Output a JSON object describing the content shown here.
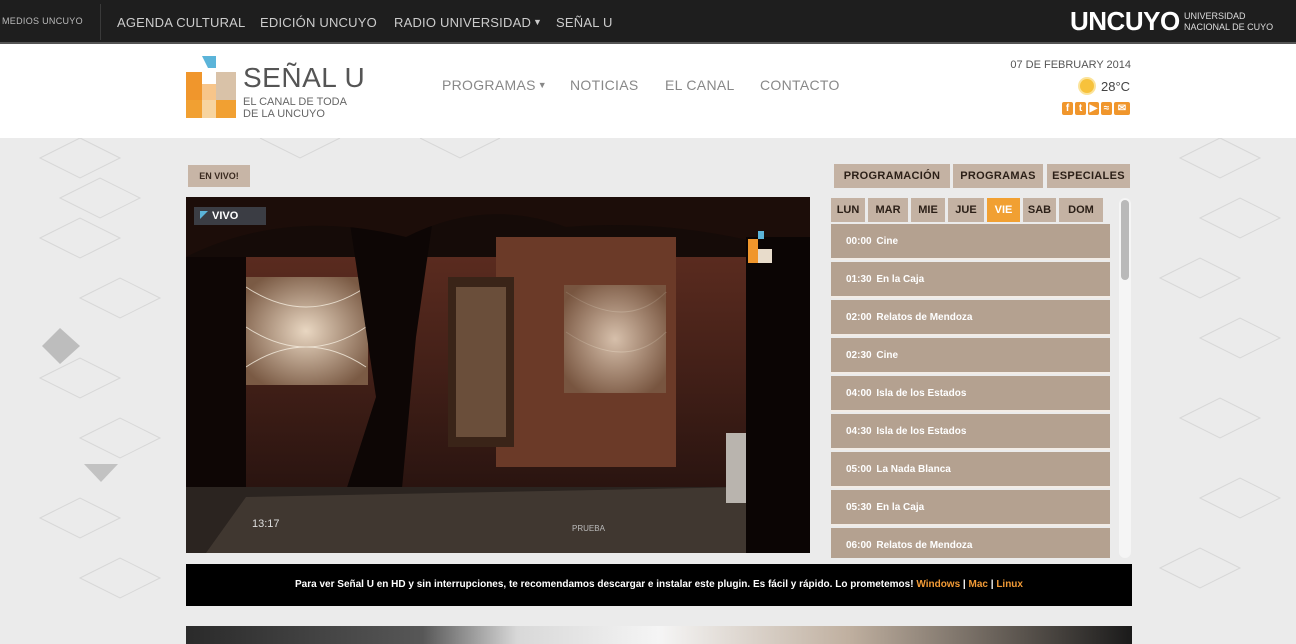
{
  "topbar": {
    "medios": "MEDIOS UNCUYO",
    "links": [
      {
        "label": "AGENDA CULTURAL"
      },
      {
        "label": "EDICIÓN UNCUYO"
      },
      {
        "label": "RADIO UNIVERSIDAD"
      },
      {
        "label": "SEÑAL U"
      }
    ],
    "brand": "UNCUYO",
    "brand_sub_1": "UNIVERSIDAD",
    "brand_sub_2": "NACIONAL DE CUYO"
  },
  "header": {
    "logo_title": "SEÑAL U",
    "logo_sub_1": "EL CANAL DE TODA",
    "logo_sub_2": "DE LA UNCUYO",
    "nav": [
      {
        "label": "PROGRAMAS"
      },
      {
        "label": "NOTICIAS"
      },
      {
        "label": "EL CANAL"
      },
      {
        "label": "CONTACTO"
      }
    ],
    "date": "07 DE FEBRUARY 2014",
    "temperature": "28°C",
    "social_icons": [
      "facebook-icon",
      "twitter-icon",
      "youtube-icon",
      "rss-icon",
      "mail-icon"
    ],
    "accent_color": "#f0962c"
  },
  "live": {
    "label": "EN VIVO!",
    "badge": "VIVO",
    "timer": "13:17",
    "caption": "PRUEBA"
  },
  "tabs": [
    "PROGRAMACIÓN",
    "PROGRAMAS",
    "ESPECIALES"
  ],
  "days": [
    "LUN",
    "MAR",
    "MIE",
    "JUE",
    "VIE",
    "SAB",
    "DOM"
  ],
  "active_day": "VIE",
  "schedule": [
    {
      "time": "00:00",
      "title": "Cine"
    },
    {
      "time": "01:30",
      "title": "En la Caja"
    },
    {
      "time": "02:00",
      "title": "Relatos de Mendoza"
    },
    {
      "time": "02:30",
      "title": "Cine"
    },
    {
      "time": "04:00",
      "title": "Isla de los Estados"
    },
    {
      "time": "04:30",
      "title": "Isla de los Estados"
    },
    {
      "time": "05:00",
      "title": "La Nada Blanca"
    },
    {
      "time": "05:30",
      "title": "En la Caja"
    },
    {
      "time": "06:00",
      "title": "Relatos de Mendoza"
    }
  ],
  "notice": {
    "text": "Para ver Señal U en HD y sin interrupciones, te recomendamos descargar e instalar este plugin. Es fácil y rápido. Lo prometemos!",
    "windows": "Windows",
    "mac": "Mac",
    "linux": "Linux"
  }
}
